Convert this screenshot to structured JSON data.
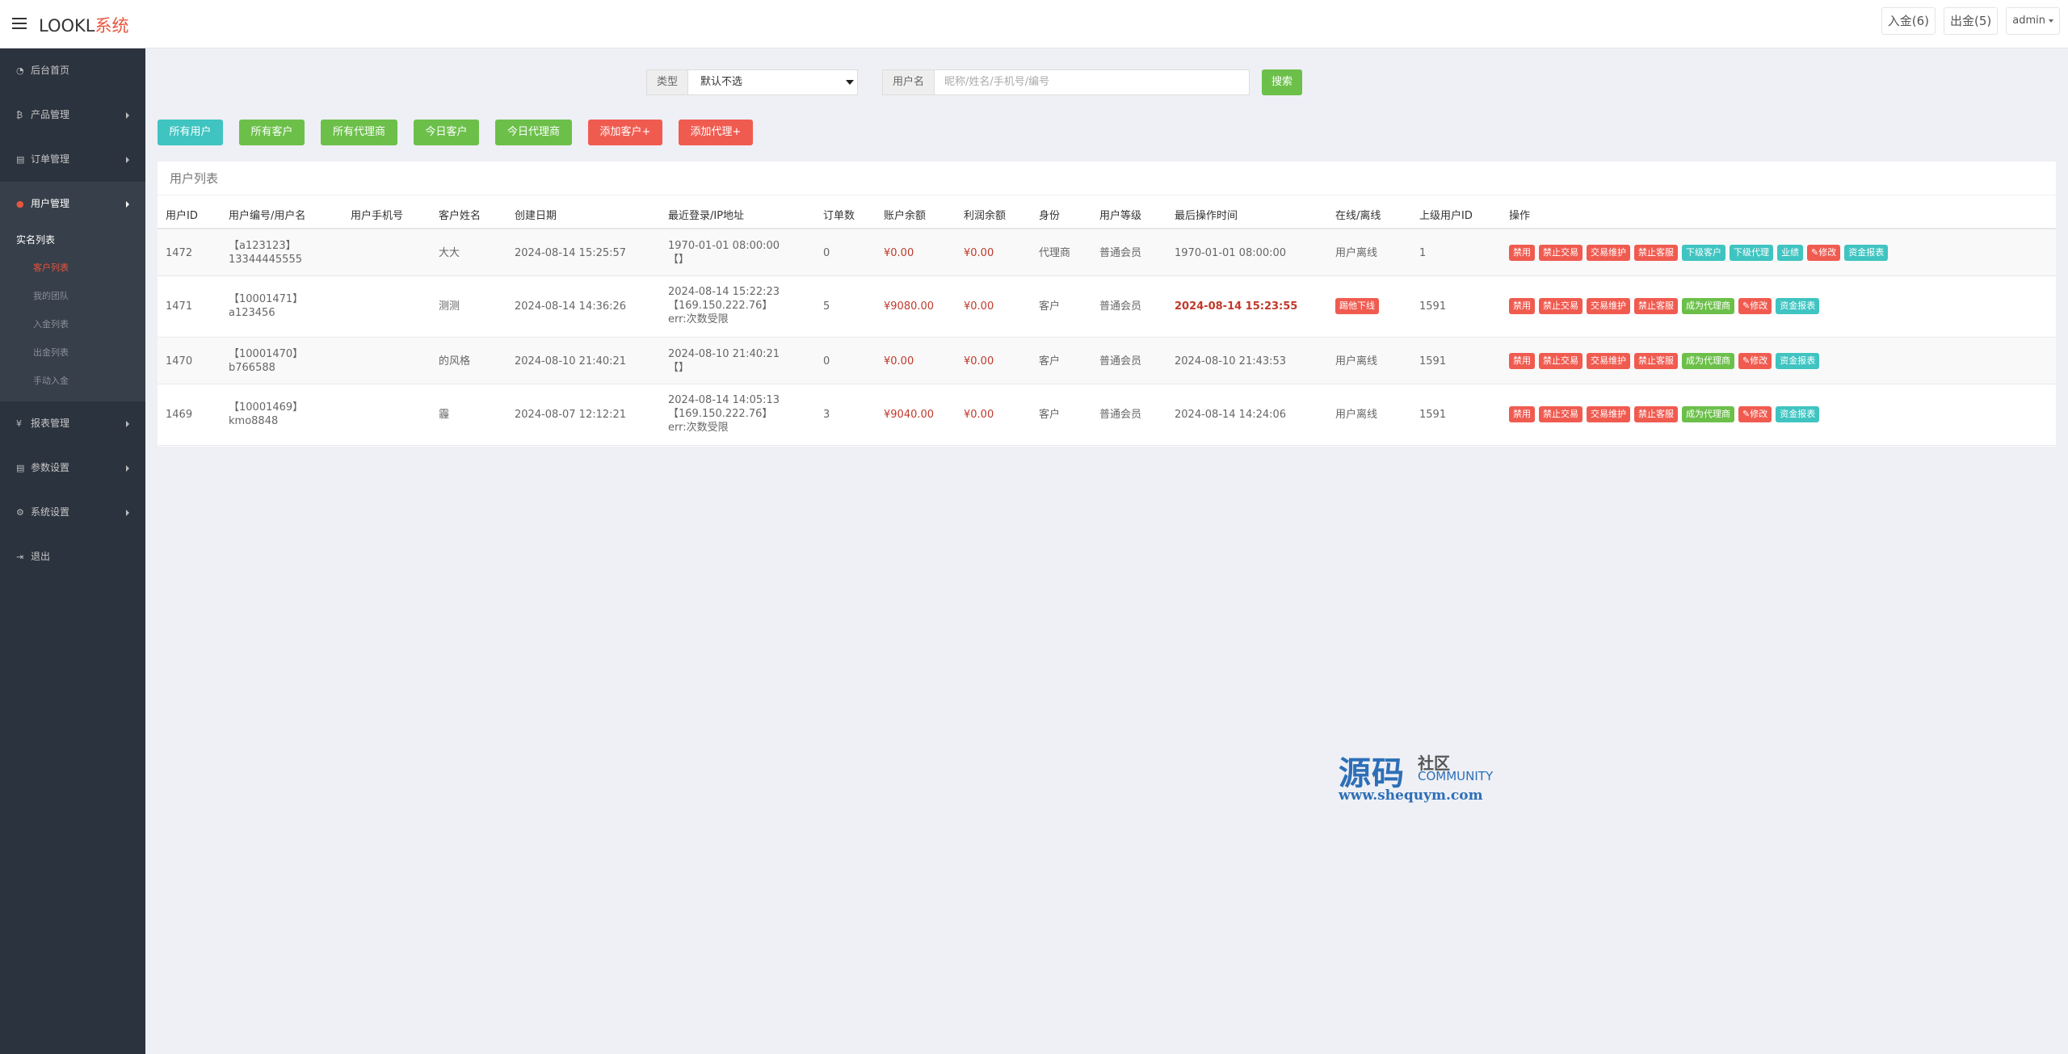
{
  "app": {
    "logo_main": "LOOKL",
    "logo_accent": "系统"
  },
  "topbar": {
    "deposit": "入金(6)",
    "withdraw": "出金(5)",
    "admin": "admin"
  },
  "sidebar": {
    "items": [
      {
        "label": "后台首页",
        "icon": "gauge-icon"
      },
      {
        "label": "产品管理",
        "icon": "bitcoin-icon"
      },
      {
        "label": "订单管理",
        "icon": "copy-icon"
      },
      {
        "label": "用户管理",
        "icon": "user-icon"
      },
      {
        "label": "报表管理",
        "icon": "yen-icon"
      },
      {
        "label": "参数设置",
        "icon": "copy-icon"
      },
      {
        "label": "系统设置",
        "icon": "gears-icon"
      },
      {
        "label": "退出",
        "icon": "signout-icon"
      }
    ],
    "sub_title": "实名列表",
    "sub_items": [
      "客户列表",
      "我的团队",
      "入金列表",
      "出金列表",
      "手动入金"
    ]
  },
  "search": {
    "type_label": "类型",
    "type_value": "默认不选",
    "user_label": "用户名",
    "user_placeholder": "昵称/姓名/手机号/编号",
    "button": "搜索"
  },
  "actions": [
    "所有用户",
    "所有客户",
    "所有代理商",
    "今日客户",
    "今日代理商",
    "添加客户+",
    "添加代理+"
  ],
  "table": {
    "title": "用户列表",
    "headers": [
      "用户ID",
      "用户编号/用户名",
      "用户手机号",
      "客户姓名",
      "创建日期",
      "最近登录/IP地址",
      "订单数",
      "账户余额",
      "利润余额",
      "身份",
      "用户等级",
      "最后操作时间",
      "在线/离线",
      "上级用户ID",
      "操作"
    ],
    "rows": [
      {
        "id": "1472",
        "code": "【a123123】",
        "name": "13344445555",
        "phone": "",
        "customer": "大大",
        "created": "2024-08-14 15:25:57",
        "login1": "1970-01-01 08:00:00",
        "login2": "【】",
        "login3": "",
        "orders": "0",
        "balance": "¥0.00",
        "profit": "¥0.00",
        "role": "代理商",
        "level": "普通会员",
        "last_op": "1970-01-01 08:00:00",
        "status": "用户离线",
        "parent": "1",
        "ops": [
          [
            "禁用",
            "red"
          ],
          [
            "禁止交易",
            "red"
          ],
          [
            "交易维护",
            "red"
          ],
          [
            "禁止客服",
            "red"
          ],
          [
            "下级客户",
            "teal"
          ],
          [
            "下级代理",
            "teal"
          ],
          [
            "业绩",
            "teal"
          ],
          [
            "✎修改",
            "red"
          ],
          [
            "资金报表",
            "teal"
          ]
        ]
      },
      {
        "id": "1471",
        "code": "【10001471】",
        "name": "a123456",
        "phone": "",
        "customer": "测测",
        "created": "2024-08-14 14:36:26",
        "login1": "2024-08-14 15:22:23",
        "login2": "【169.150.222.76】",
        "login3": "err:次数受限",
        "orders": "5",
        "balance": "¥9080.00",
        "profit": "¥0.00",
        "role": "客户",
        "level": "普通会员",
        "last_op": "2024-08-14 15:23:55",
        "status": "踢他下线",
        "parent": "1591",
        "ops": [
          [
            "禁用",
            "red"
          ],
          [
            "禁止交易",
            "red"
          ],
          [
            "交易维护",
            "red"
          ],
          [
            "禁止客服",
            "red"
          ],
          [
            "成为代理商",
            "green"
          ],
          [
            "✎修改",
            "red"
          ],
          [
            "资金报表",
            "teal"
          ]
        ]
      },
      {
        "id": "1470",
        "code": "【10001470】",
        "name": "b766588",
        "phone": "",
        "customer": "的风格",
        "created": "2024-08-10 21:40:21",
        "login1": "2024-08-10 21:40:21",
        "login2": "【】",
        "login3": "",
        "orders": "0",
        "balance": "¥0.00",
        "profit": "¥0.00",
        "role": "客户",
        "level": "普通会员",
        "last_op": "2024-08-10 21:43:53",
        "status": "用户离线",
        "parent": "1591",
        "ops": [
          [
            "禁用",
            "red"
          ],
          [
            "禁止交易",
            "red"
          ],
          [
            "交易维护",
            "red"
          ],
          [
            "禁止客服",
            "red"
          ],
          [
            "成为代理商",
            "green"
          ],
          [
            "✎修改",
            "red"
          ],
          [
            "资金报表",
            "teal"
          ]
        ]
      },
      {
        "id": "1469",
        "code": "【10001469】",
        "name": "kmo8848",
        "phone": "",
        "customer": "霾",
        "created": "2024-08-07 12:12:21",
        "login1": "2024-08-14 14:05:13",
        "login2": "【169.150.222.76】",
        "login3": "err:次数受限",
        "orders": "3",
        "balance": "¥9040.00",
        "profit": "¥0.00",
        "role": "客户",
        "level": "普通会员",
        "last_op": "2024-08-14 14:24:06",
        "status": "用户离线",
        "parent": "1591",
        "ops": [
          [
            "禁用",
            "red"
          ],
          [
            "禁止交易",
            "red"
          ],
          [
            "交易维护",
            "red"
          ],
          [
            "禁止客服",
            "red"
          ],
          [
            "成为代理商",
            "green"
          ],
          [
            "✎修改",
            "red"
          ],
          [
            "资金报表",
            "teal"
          ]
        ]
      }
    ]
  },
  "watermark": {
    "big": "源码",
    "small": "社区",
    "community": "COMMUNITY",
    "url": "www.shequym.com"
  },
  "colors": {
    "red": "#f05b50",
    "teal": "#3fc4c1",
    "green": "#6cc04a",
    "sidebar": "#2b333e",
    "accent": "#e8553e"
  }
}
